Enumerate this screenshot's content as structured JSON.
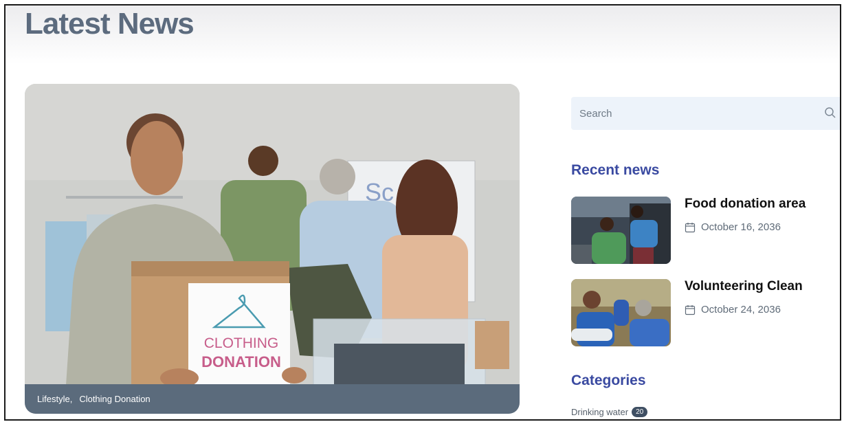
{
  "header": {
    "title": "Latest News"
  },
  "featured": {
    "categories": [
      "Lifestyle,",
      "Clothing Donation"
    ],
    "box_label_line1": "CLOTHING",
    "box_label_line2": "DONATION",
    "board_text": "Sc"
  },
  "sidebar": {
    "search": {
      "placeholder": "Search"
    },
    "recent": {
      "heading": "Recent news",
      "items": [
        {
          "title": "Food donation area",
          "date": "October 16, 2036"
        },
        {
          "title": "Volunteering Clean",
          "date": "October 24, 2036"
        }
      ]
    },
    "categories": {
      "heading": "Categories",
      "items": [
        {
          "name": "Drinking water",
          "count": "20"
        }
      ]
    }
  },
  "colors": {
    "title": "#5c6b7e",
    "accent": "#3a4aa1",
    "search_bg": "#edf3fa",
    "featured_bar": "#5b6b7c"
  },
  "icons": [
    "search-icon",
    "calendar-icon"
  ]
}
